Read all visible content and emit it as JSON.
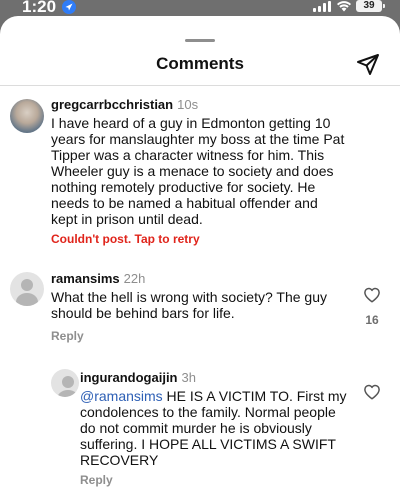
{
  "status_bar": {
    "time": "1:20",
    "battery": "39"
  },
  "sheet": {
    "title": "Comments"
  },
  "comments": [
    {
      "username": "gregcarrbcchristian",
      "time": "10s",
      "lines": [
        "I have heard of a guy in Edmonton getting 10",
        "years for manslaughter my boss at the time Pat",
        "Tipper was a character witness for him. This",
        "Wheeler guy is a menace to society and does",
        "nothing remotely productive for society. He",
        "needs to be named a habitual offender and",
        "kept in prison until dead."
      ],
      "error": "Couldn't post. Tap to retry"
    },
    {
      "username": "ramansims",
      "time": "22h",
      "lines": [
        "What the hell is wrong with society? The guy",
        "should be behind bars for life."
      ],
      "reply_label": "Reply",
      "likes": "16"
    },
    {
      "username": "ingurandogaijin",
      "time": "3h",
      "mention": "@ramansims",
      "lines": [
        " HE IS A VICTIM TO. First my",
        "condolences to the family. Normal people",
        "do not commit murder he is obviously",
        "suffering. I HOPE ALL VICTIMS A SWIFT",
        "RECOVERY"
      ],
      "reply_label": "Reply"
    }
  ],
  "icons": {
    "send": "send-icon",
    "heart": "heart-icon",
    "location": "location-arrow-icon"
  },
  "colors": {
    "error": "#e0241b",
    "mention": "#2d5fb5",
    "secondary_text": "#8e8e8e"
  }
}
